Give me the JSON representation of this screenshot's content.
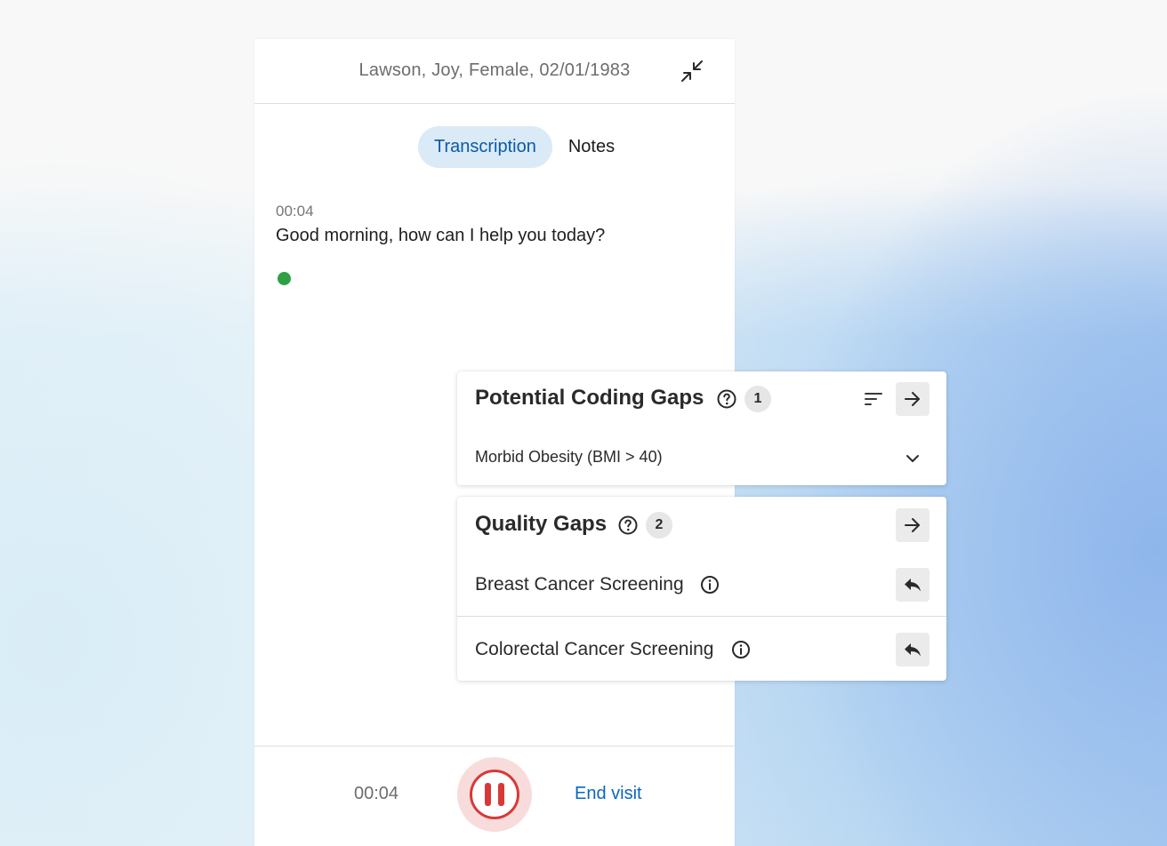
{
  "header": {
    "patient": "Lawson, Joy, Female, 02/01/1983",
    "collapse_icon": "collapse-arrows-icon"
  },
  "tabs": [
    {
      "label": "Transcription",
      "active": true
    },
    {
      "label": "Notes",
      "active": false
    }
  ],
  "transcript": {
    "timestamp": "00:04",
    "text": "Good morning, how can I help you today?",
    "live_indicator_color": "#2ea043"
  },
  "footer": {
    "elapsed": "00:04",
    "pause_icon": "pause-icon",
    "end_visit_label": "End visit"
  },
  "coding_gaps": {
    "title": "Potential Coding Gaps",
    "count": "1",
    "items": [
      {
        "label": "Morbid Obesity (BMI > 40)"
      }
    ]
  },
  "quality_gaps": {
    "title": "Quality Gaps",
    "count": "2",
    "items": [
      {
        "label": "Breast Cancer Screening"
      },
      {
        "label": "Colorectal Cancer Screening"
      }
    ]
  },
  "colors": {
    "accent_blue": "#0a66c2",
    "tab_active_bg": "#dbeaf7",
    "record_red": "#d93838"
  }
}
